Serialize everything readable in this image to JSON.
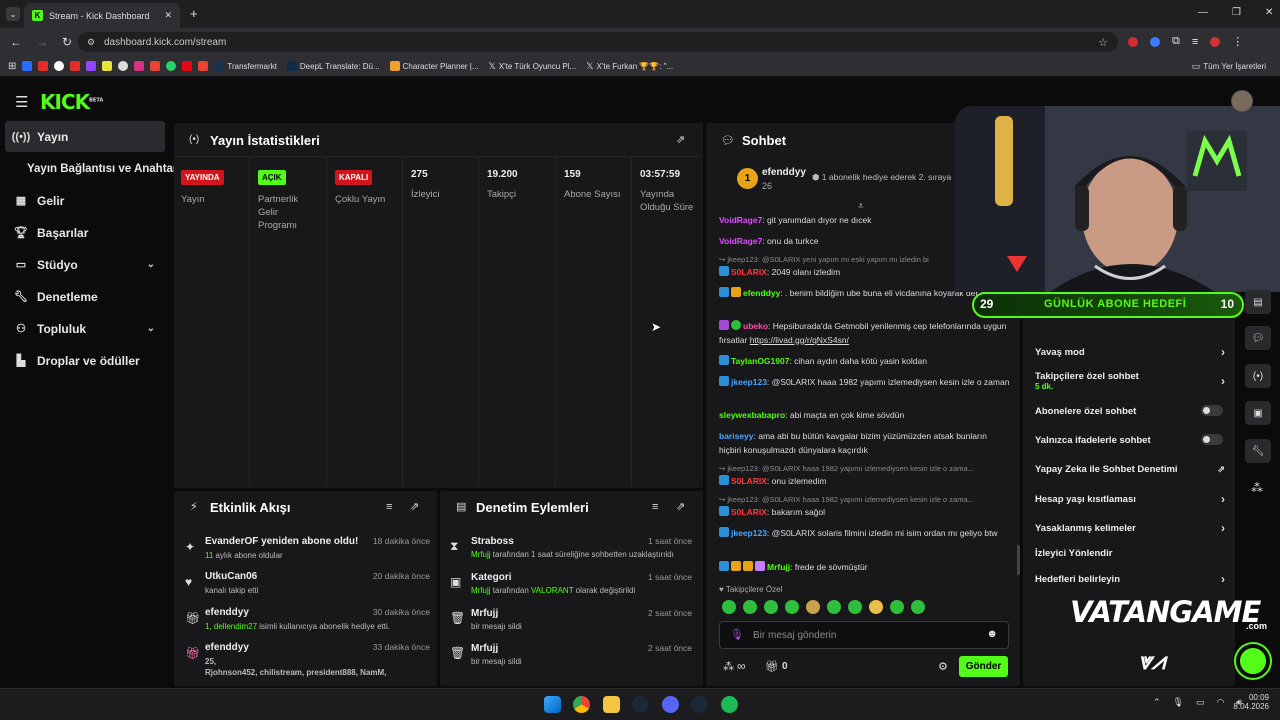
{
  "browser": {
    "tab_title": "Stream - Kick Dashboard",
    "url": "dashboard.kick.com/stream",
    "bookmarks": [
      "Transfermarkt",
      "DeepL Translate: Dü...",
      "Character Planner |...",
      "X'te Türk Oyuncu Pl...",
      "X'te Furkan 🏆🏆: \"..."
    ],
    "all_bookmarks": "Tüm Yer İşaretleri"
  },
  "header": {
    "logo": "KICK",
    "beta": "BETA"
  },
  "sidebar": {
    "items": [
      {
        "label": "Yayın",
        "icon": "broadcast-icon"
      },
      {
        "label": "Yayın Bağlantısı ve Anahtarı",
        "icon": ""
      },
      {
        "label": "Gelir",
        "icon": "chart-icon"
      },
      {
        "label": "Başarılar",
        "icon": "trophy-icon"
      },
      {
        "label": "Stüdyo",
        "icon": "studio-icon"
      },
      {
        "label": "Denetleme",
        "icon": "wrench-icon"
      },
      {
        "label": "Topluluk",
        "icon": "community-icon"
      },
      {
        "label": "Droplar ve ödüller",
        "icon": "drops-icon"
      }
    ]
  },
  "stats": {
    "title": "Yayın İstatistikleri",
    "cells": [
      {
        "value": "YAYINDA",
        "label": "Yayın",
        "kind": "badge-red"
      },
      {
        "value": "AÇIK",
        "label": "Partnerlik Gelir Programı",
        "kind": "badge-green"
      },
      {
        "value": "KAPALI",
        "label": "Çoklu Yayın",
        "kind": "badge-red"
      },
      {
        "value": "275",
        "label": "İzleyici",
        "kind": "text"
      },
      {
        "value": "19.200",
        "label": "Takipçi",
        "kind": "text"
      },
      {
        "value": "159",
        "label": "Abone Sayısı",
        "kind": "text"
      },
      {
        "value": "03:57:59",
        "label": "Yayında Olduğu Süre",
        "kind": "text"
      }
    ]
  },
  "activity": {
    "title": "Etkinlik Akışı",
    "items": [
      {
        "name": "EvanderOF yeniden abone oldu!",
        "sub_hl": "11",
        "sub": " aylık abone oldular",
        "time": "18 dakika önce"
      },
      {
        "name": "UtkuCan06",
        "sub_hl": "",
        "sub": "kanalı takip etti",
        "time": "20 dakika önce"
      },
      {
        "name": "efenddyy",
        "sub_hl": "1, dellendim27",
        "sub": " isimli kullanıcıya abonelik hediye etti.",
        "time": "30 dakika önce"
      },
      {
        "name": "efenddyy",
        "sub_hl": "25,",
        "sub": "",
        "sub2": "Rjohnson452, chilistream, president888, NamM,",
        "time": "33 dakika önce"
      }
    ]
  },
  "moderation": {
    "title": "Denetim Eylemleri",
    "items": [
      {
        "name": "Straboss",
        "actor": "Mrfujj",
        "sub": " tarafından 1 saat süreliğine sohbetten uzaklaştırıldı",
        "time": "1 saat önce"
      },
      {
        "name": "Kategori",
        "actor": "Mrfujj",
        "sub": " tarafından ",
        "hl2": "VALORANT",
        "sub2": " olarak değiştirildi",
        "time": "1 saat önce"
      },
      {
        "name": "Mrfujj",
        "actor": "",
        "sub": "bir mesajı sildi",
        "time": "2 saat önce"
      },
      {
        "name": "Mrfujj",
        "actor": "",
        "sub": "bir mesajı sildi",
        "time": "2 saat önce"
      }
    ]
  },
  "chat": {
    "title": "Sohbet",
    "pinned_user": "efenddyy",
    "pinned_rank": "1",
    "pinned_count": "26",
    "pinned_text": "1 abonelik hediye ederek 2. sıraya",
    "messages": [
      {
        "user": "VoidRage7",
        "color": "#e04bff",
        "text": ": git yanımdan dıyor ne dıcek"
      },
      {
        "user": "VoidRage7",
        "color": "#e04bff",
        "text": ": onu da turkce"
      },
      {
        "reply": "jkeep123: @S0LARIX yeni yapım mı eski yapım mı izledin bi"
      },
      {
        "user": "S0LARIX",
        "color": "#ff3a3a",
        "text": ": 2049 olanı izledim"
      },
      {
        "user": "efenddyy",
        "color": "#53fc18",
        "text": ": . benim bildiğim ube buna eli vicdanına koyarak der :)))))"
      },
      {
        "user": "ubeko",
        "color": "#ff4fa3",
        "text": ": Hepsiburada'da Getmobil yenilenmiş cep telefonlarında uygun fırsatlar ",
        "link": "https://livad.gg/r/qNxS4sn/"
      },
      {
        "user": "TaylanOG1907",
        "color": "#53fc18",
        "text": ": cihan aydın daha kötü yasin koldan"
      },
      {
        "user": "jkeep123",
        "color": "#4aa3ff",
        "text": ": @S0LARIX haaa 1982 yapımı izlemediysen kesin izle o zaman"
      },
      {
        "user": "sleywexbabapro",
        "color": "#53fc18",
        "text": ": abi maçta en çok kime sövdün"
      },
      {
        "user": "bariseyy",
        "color": "#4aa3ff",
        "text": ": ama abi bu bütün kavgalar bizim yüzümüzden atsak bunların hiçbiri konuşulmazdı dünyalara kaçırdık"
      },
      {
        "reply": "jkeep123: @S0LARIX haaa 1982 yapımı izlemediysen kesin izle o zama..."
      },
      {
        "user": "S0LARIX",
        "color": "#ff3a3a",
        "text": ": onu izlemedim"
      },
      {
        "reply": "jkeep123: @S0LARIX haaa 1982 yapımı izlemediysen kesin izle o zama..."
      },
      {
        "user": "S0LARIX",
        "color": "#ff3a3a",
        "text": ": bakarım sağol"
      },
      {
        "user": "jkeep123",
        "color": "#4aa3ff",
        "text": ": @S0LARIX solaris filmini izledin mi isim ordan mı geliyo btw"
      },
      {
        "user": "Mrfujj",
        "color": "#53fc18",
        "text": ": frede de sövmüştür"
      }
    ],
    "followers_only_label": "Takipçilere Özel",
    "input_placeholder": "Bir mesaj gönderin",
    "send_label": "Gönder",
    "infinity": "∞",
    "gift_count": "0"
  },
  "settings": {
    "items": [
      {
        "label": "Yavaş mod",
        "control": "arrow"
      },
      {
        "label": "Takipçilere özel sohbet",
        "sub": "5 dk.",
        "control": "arrow"
      },
      {
        "label": "Abonelere özel sohbet",
        "control": "toggle"
      },
      {
        "label": "Yalnızca ifadelerle sohbet",
        "control": "toggle"
      },
      {
        "label": "Yapay Zeka ile Sohbet Denetimi",
        "control": "external"
      },
      {
        "label": "Hesap yaşı kısıtlaması",
        "control": "arrow"
      },
      {
        "label": "Yasaklanmış kelimeler",
        "control": "arrow"
      },
      {
        "label": "İzleyici Yönlendir",
        "control": "none"
      },
      {
        "label": "Hedefleri belirleyin",
        "control": "arrow"
      }
    ]
  },
  "overlay": {
    "goal_left": "29",
    "goal_label": "GÜNLÜK ABONE HEDEFİ",
    "goal_right": "10",
    "brand_main": "VATANGAME",
    "brand_sub": ".com"
  },
  "taskbar": {
    "time": "00:09",
    "date": "8.04.2026"
  },
  "colors": {
    "kick_green": "#53fc18",
    "panel": "#18181b",
    "background": "#0b0b0c"
  }
}
